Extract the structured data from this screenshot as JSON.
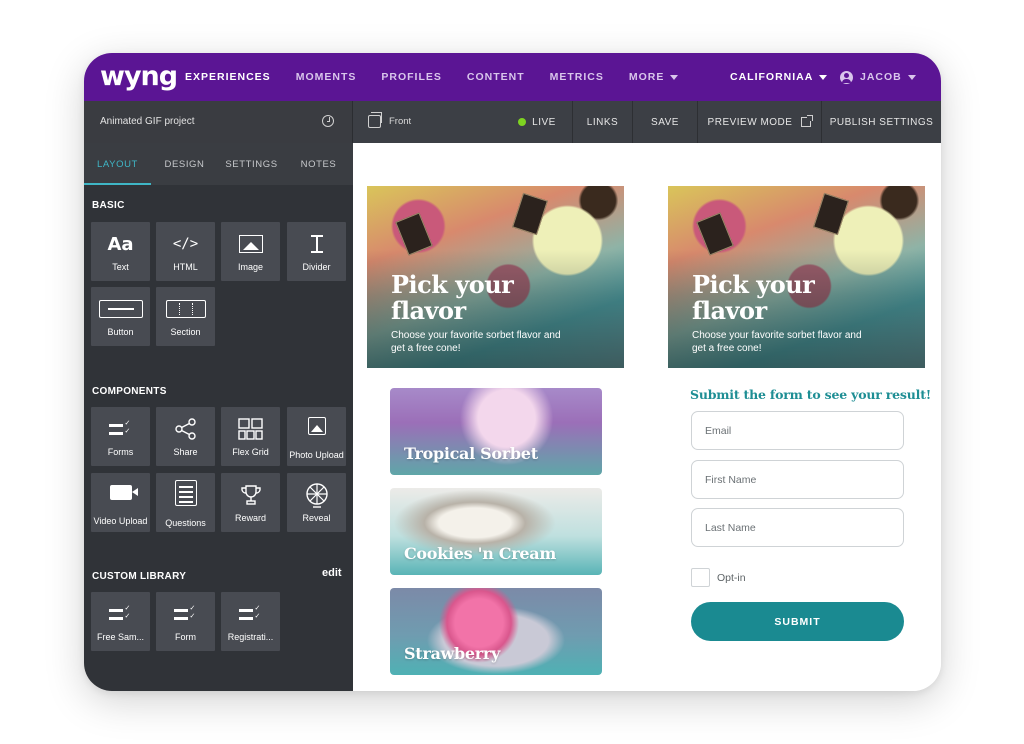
{
  "nav": {
    "logo": "wyng",
    "items": [
      "EXPERIENCES",
      "MOMENTS",
      "PROFILES",
      "CONTENT",
      "METRICS",
      "MORE"
    ],
    "region": "CALIFORNIAA",
    "user": "JACOB"
  },
  "toolbar": {
    "project_name": "Animated GIF project",
    "view": "Front",
    "live": "LIVE",
    "links": "LINKS",
    "save": "SAVE",
    "preview": "PREVIEW MODE",
    "publish": "PUBLISH SETTINGS"
  },
  "sidebar": {
    "tabs": [
      "LAYOUT",
      "DESIGN",
      "SETTINGS",
      "NOTES"
    ],
    "basic_title": "BASIC",
    "basic": {
      "text_icon": "Aa",
      "html_icon": "</>",
      "labels": [
        "Text",
        "HTML",
        "Image",
        "Divider",
        "Button",
        "Section"
      ]
    },
    "components_title": "COMPONENTS",
    "components": [
      "Forms",
      "Share",
      "Flex Grid",
      "Photo Upload",
      "Video Upload",
      "Questions",
      "Reward",
      "Reveal"
    ],
    "custom_title": "CUSTOM LIBRARY",
    "custom_edit": "edit",
    "custom": [
      "Free Sam...",
      "Form",
      "Registrati..."
    ]
  },
  "canvas": {
    "hero_title": "Pick your flavor",
    "hero_subtitle": "Choose your favorite sorbet flavor and get a free cone!",
    "flavors": [
      "Tropical Sorbet",
      "Cookies 'n Cream",
      "Strawberry"
    ],
    "form": {
      "title": "Submit the form to see your result!",
      "email": "Email",
      "first_name": "First Name",
      "last_name": "Last Name",
      "optin": "Opt-in",
      "submit": "SUBMIT"
    }
  },
  "colors": {
    "nav_purple": "#5b1594",
    "sidebar_dark": "#303338",
    "accent_teal": "#1a8a91",
    "live_green": "#7ed321"
  }
}
